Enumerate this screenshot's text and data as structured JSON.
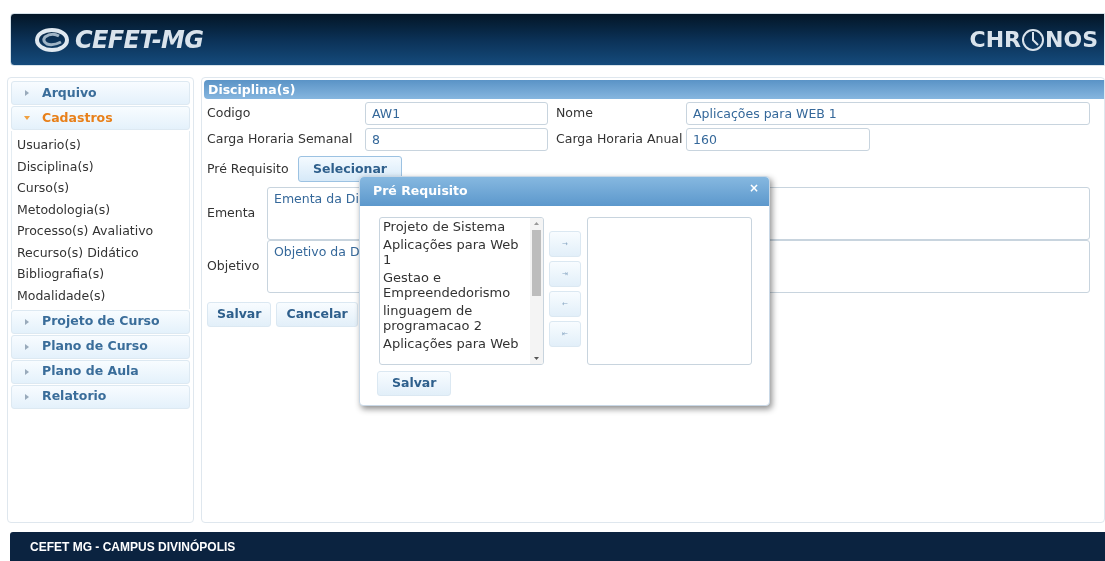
{
  "header": {
    "logo_left": "CEFET-MG",
    "logo_right": {
      "before": "CHR",
      "after": "NOS"
    }
  },
  "sidebar": {
    "sections": [
      {
        "label": "Arquivo",
        "expanded": false
      },
      {
        "label": "Cadastros",
        "expanded": true,
        "items": [
          "Usuario(s)",
          "Disciplina(s)",
          "Curso(s)",
          "Metodologia(s)",
          "Processo(s) Avaliativo",
          "Recurso(s) Didático",
          "Bibliografia(s)",
          "Modalidade(s)"
        ]
      },
      {
        "label": "Projeto de Curso",
        "expanded": false
      },
      {
        "label": "Plano de Curso",
        "expanded": false
      },
      {
        "label": "Plano de Aula",
        "expanded": false
      },
      {
        "label": "Relatorio",
        "expanded": false
      }
    ]
  },
  "panel": {
    "title": "Disciplina(s)",
    "codigo": {
      "label": "Codigo",
      "value": "AW1"
    },
    "nome": {
      "label": "Nome",
      "value": "Aplicações para WEB 1"
    },
    "carga_semanal": {
      "label": "Carga Horaria Semanal",
      "value": "8"
    },
    "carga_anual": {
      "label": "Carga Horaria Anual",
      "value": "160"
    },
    "pre_requisito": {
      "label": "Pré Requisito",
      "button": "Selecionar"
    },
    "ementa": {
      "label": "Ementa",
      "value": "Ementa da Di"
    },
    "objetivo": {
      "label": "Objetivo",
      "value": "Objetivo da D"
    },
    "buttons": [
      "Salvar",
      "Cancelar"
    ]
  },
  "dialog": {
    "title": "Pré Requisito",
    "close": "×",
    "available": [
      "Projeto de Sistema",
      "Aplicações para Web 1",
      "Gestao e Empreendedorismo",
      "linguagem de programacao 2",
      "Aplicações para Web"
    ],
    "move_buttons": [
      "→",
      "⇥",
      "←",
      "⇤"
    ],
    "button": "Salvar"
  },
  "footer": "CEFET MG - CAMPUS DIVINÓPOLIS"
}
